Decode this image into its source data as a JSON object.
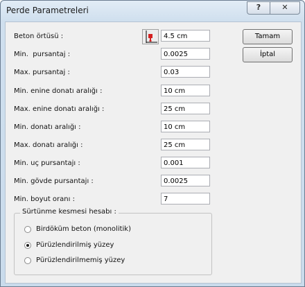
{
  "window": {
    "title": "Perde Parametreleri",
    "help_label": "?",
    "close_label": "✕"
  },
  "fields": [
    {
      "label": "Beton örtüsü :",
      "value": "4.5 cm"
    },
    {
      "label": "Min.  pursantaj :",
      "value": "0.0025"
    },
    {
      "label": "Max. pursantaj :",
      "value": "0.03"
    },
    {
      "label": "Min. enine donatı aralığı :",
      "value": "10 cm"
    },
    {
      "label": "Max. enine donatı aralığı :",
      "value": "25 cm"
    },
    {
      "label": "Min. donatı aralığı :",
      "value": "10 cm"
    },
    {
      "label": "Max. donatı aralığı :",
      "value": "25 cm"
    },
    {
      "label": "Min. uç pursantajı :",
      "value": "0.001"
    },
    {
      "label": "Min. gövde pursantajı :",
      "value": "0.0025"
    },
    {
      "label": "Min. boyut oranı :",
      "value": "7"
    }
  ],
  "buttons": {
    "ok": "Tamam",
    "cancel": "İptal"
  },
  "friction_group": {
    "title": "Sürtünme kesmesi hesabı :",
    "options": [
      {
        "label": "Birdöküm beton (monolitik)",
        "selected": false
      },
      {
        "label": "Pürüzlendirilmiş yüzey",
        "selected": true
      },
      {
        "label": "Pürüzlendirilmemiş yüzey",
        "selected": false
      }
    ]
  },
  "icons": {
    "cover_icon": "concrete-cover-icon"
  },
  "colors": {
    "cover_icon_red": "#d42020"
  }
}
